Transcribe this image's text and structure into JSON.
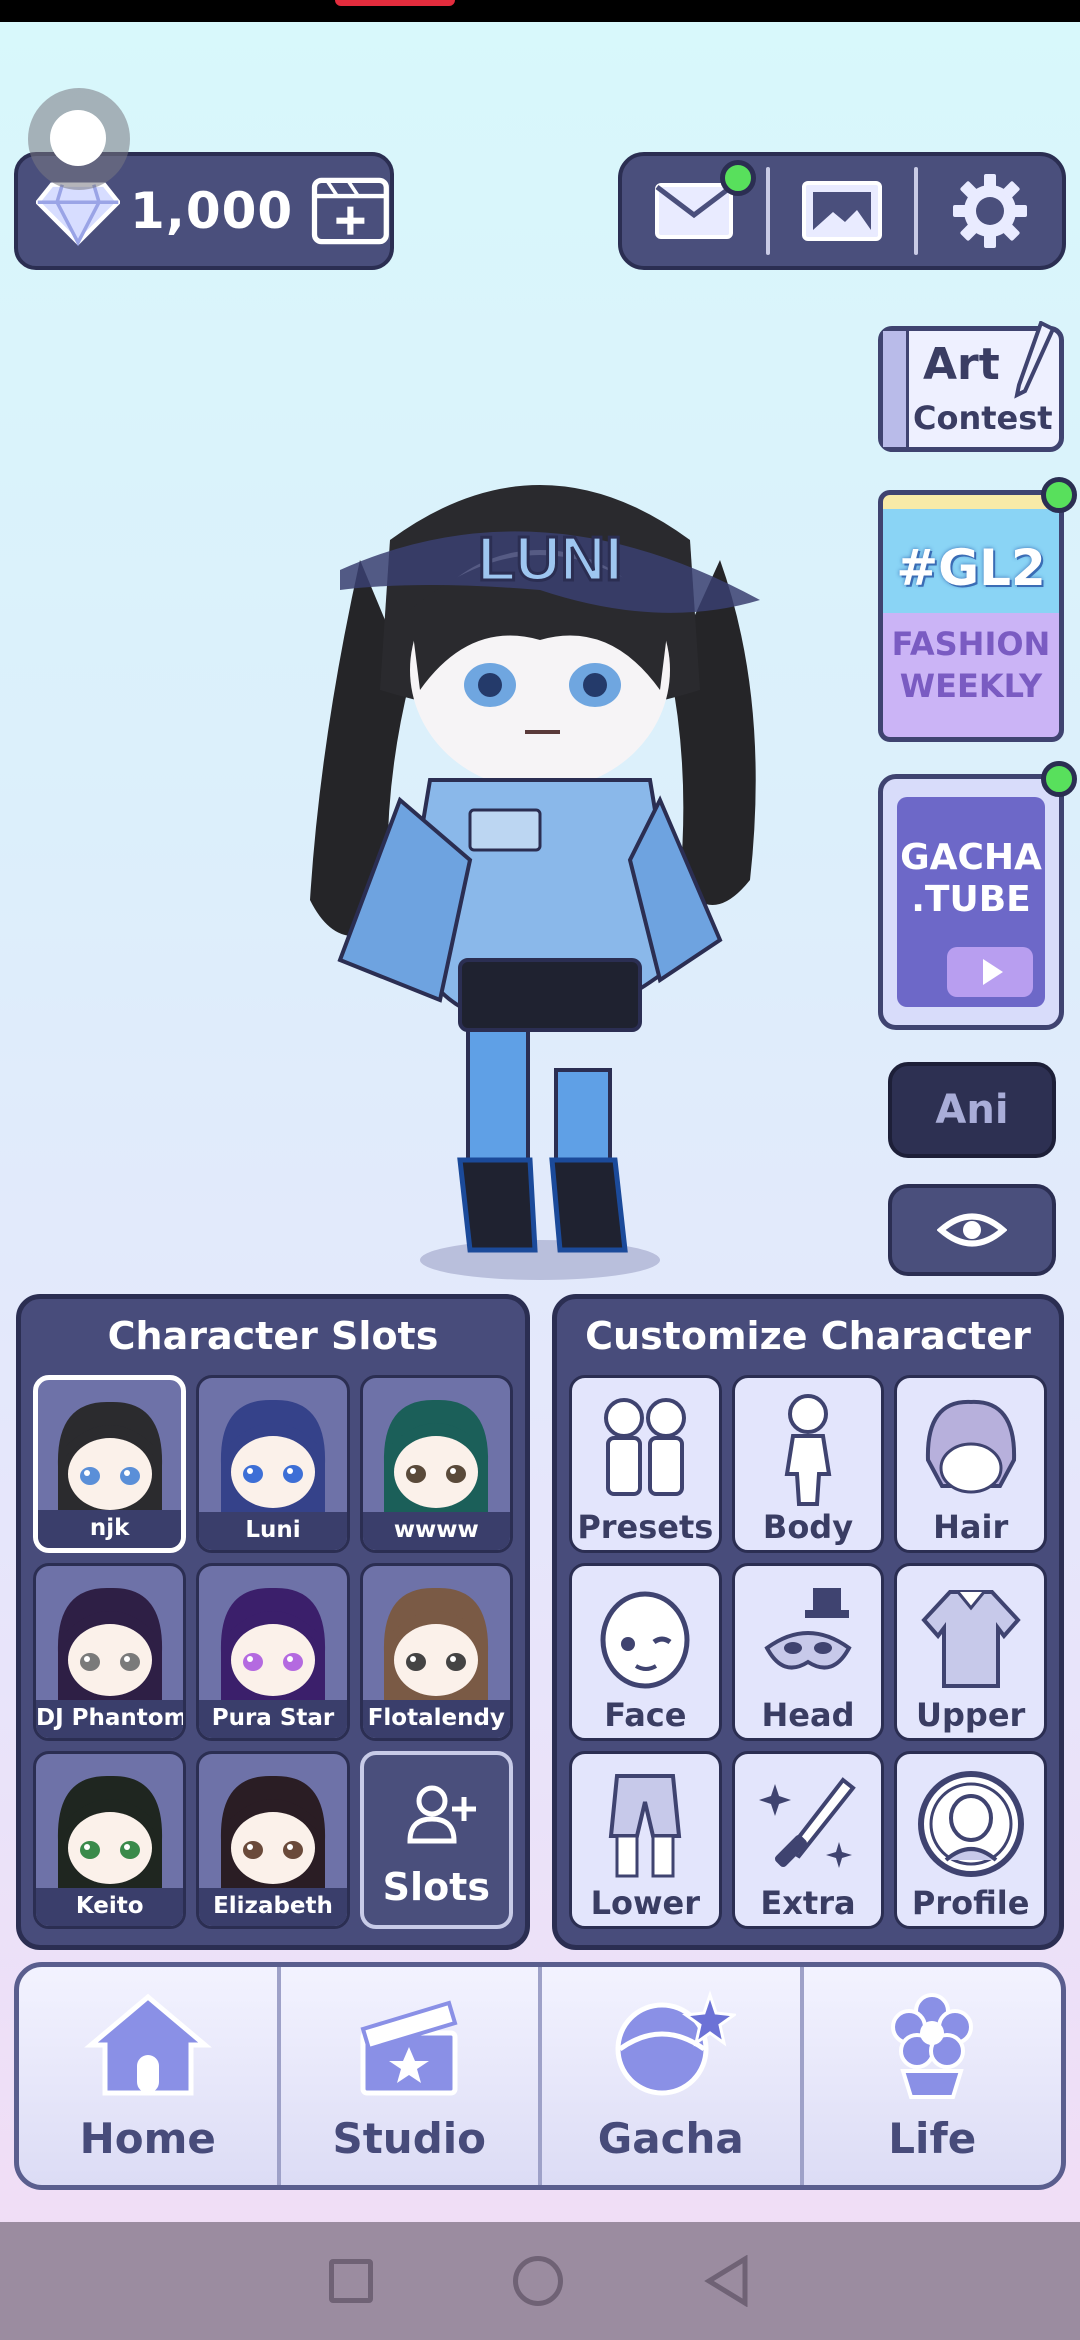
{
  "currency": {
    "amount": "1,000"
  },
  "side_buttons": {
    "art_contest": {
      "line1": "Art",
      "line2": "Contest"
    },
    "fashion": {
      "line1": "#GL2",
      "line2": "FASHION",
      "line3": "WEEKLY"
    },
    "tube": {
      "line1": "GACHA",
      "line2": ".TUBE"
    },
    "ani_label": "Ani"
  },
  "character": {
    "hat_text": "LUNI"
  },
  "slots_panel": {
    "title": "Character Slots",
    "slots": [
      {
        "name": "njk",
        "hair": "#2b2b2e",
        "eyes": "#5a8fd8"
      },
      {
        "name": "Luni",
        "hair": "#35428a",
        "eyes": "#3d6fd6"
      },
      {
        "name": "wwww",
        "hair": "#1b5f59",
        "eyes": "#5a4a3a"
      },
      {
        "name": "DJ Phantom",
        "hair": "#2e1f45",
        "eyes": "#7a7a7a"
      },
      {
        "name": "Pura Star",
        "hair": "#3b1f6b",
        "eyes": "#b46ae0"
      },
      {
        "name": "Flotalendy",
        "hair": "#7a5a45",
        "eyes": "#444"
      },
      {
        "name": "Keito",
        "hair": "#1f2620",
        "eyes": "#3a8a4a"
      },
      {
        "name": "Elizabeth",
        "hair": "#2a1d24",
        "eyes": "#6a4a3a"
      }
    ],
    "add_label": "Slots"
  },
  "customize_panel": {
    "title": "Customize Character",
    "items": [
      "Presets",
      "Body",
      "Hair",
      "Face",
      "Head",
      "Upper",
      "Lower",
      "Extra",
      "Profile"
    ]
  },
  "bottom_nav": [
    "Home",
    "Studio",
    "Gacha",
    "Life"
  ],
  "colors": {
    "navy": "#4a4f7c",
    "outline": "#2b2e52",
    "notification": "#58e05c"
  }
}
